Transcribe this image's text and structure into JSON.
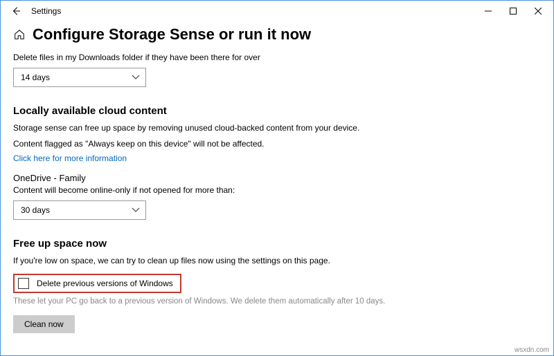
{
  "app_title": "Settings",
  "page_title": "Configure Storage Sense or run it now",
  "downloads": {
    "label": "Delete files in my Downloads folder if they have been there for over",
    "selected": "14 days"
  },
  "cloud": {
    "heading": "Locally available cloud content",
    "line1": "Storage sense can free up space by removing unused cloud-backed content from your device.",
    "line2": "Content flagged as \"Always keep on this device\" will not be affected.",
    "more_link": "Click here for more information"
  },
  "onedrive": {
    "heading": "OneDrive - Family",
    "label": "Content will become online-only if not opened for more than:",
    "selected": "30 days"
  },
  "free_up": {
    "heading": "Free up space now",
    "intro": "If you're low on space, we can try to clean up files now using the settings on this page.",
    "checkbox_label": "Delete previous versions of Windows",
    "explain": "These let your PC go back to a previous version of Windows. We delete them automatically after 10 days.",
    "button": "Clean now"
  },
  "watermark": "wsxdn.com"
}
